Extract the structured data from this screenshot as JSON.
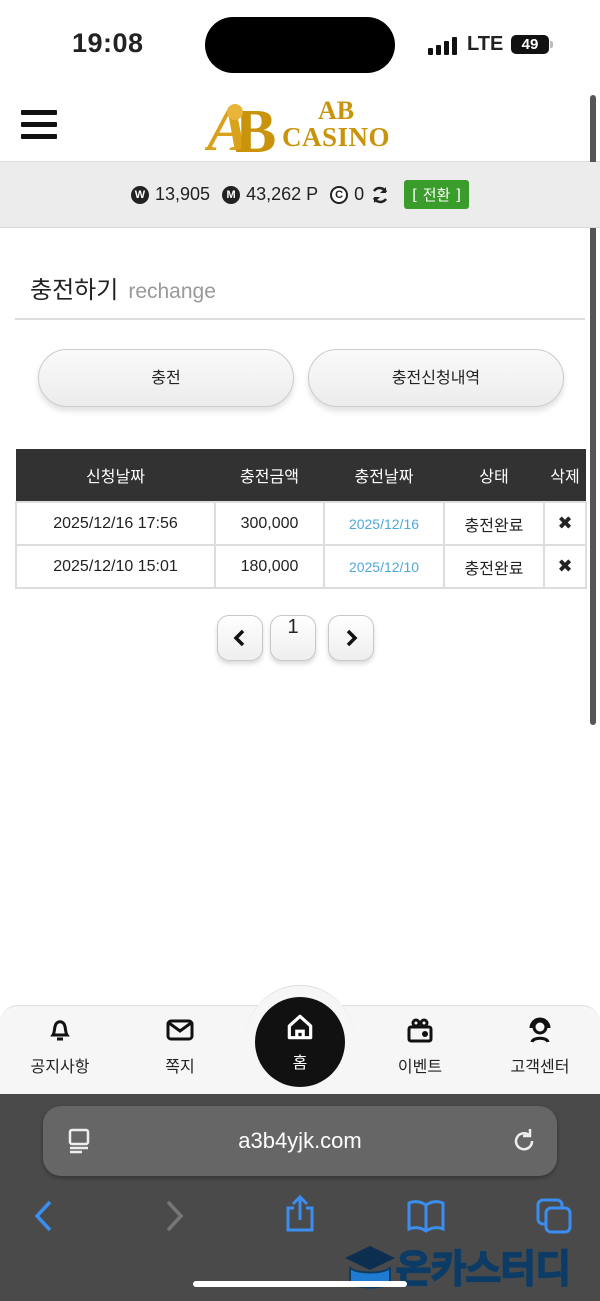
{
  "status_bar": {
    "time": "19:08",
    "network": "LTE",
    "battery": "49"
  },
  "header": {
    "logo_top": "AB",
    "logo_bottom": "CASINO",
    "logo_mark": "AB"
  },
  "balance": {
    "won_icon": "Ⓦ",
    "won_value": "13,905",
    "money_icon": "Ⓜ",
    "money_value": "43,262 P",
    "coin_icon": "Ⓒ",
    "coin_value": "0",
    "refresh_icon": "refresh-icon",
    "convert_label": "[ 전환 ]"
  },
  "page": {
    "title": "충전하기",
    "subtitle": "rechange"
  },
  "buttons": {
    "charge": "충전",
    "history": "충전신청내역"
  },
  "table": {
    "headers": [
      "신청날짜",
      "충전금액",
      "충전날짜",
      "상태",
      "삭제"
    ],
    "rows": [
      {
        "requested": "2025/12/16 17:56",
        "amount": "300,000",
        "charged": "2025/12/16",
        "status": "충전완료",
        "delete": "✖"
      },
      {
        "requested": "2025/12/10 15:01",
        "amount": "180,000",
        "charged": "2025/12/10",
        "status": "충전완료",
        "delete": "✖"
      }
    ]
  },
  "pagination": {
    "prev": "‹",
    "current": "1",
    "next": "›"
  },
  "tabbar": {
    "notice": "공지사항",
    "message": "쪽지",
    "home": "홈",
    "event": "이벤트",
    "support": "고객센터"
  },
  "browser": {
    "url": "a3b4yjk.com"
  },
  "watermark": {
    "text": "온카스터디"
  },
  "colors": {
    "accent_green": "#3a9c2a",
    "gold": "#c9940c",
    "link_blue": "#4fa9d8",
    "ios_blue": "#3b8ef0"
  }
}
